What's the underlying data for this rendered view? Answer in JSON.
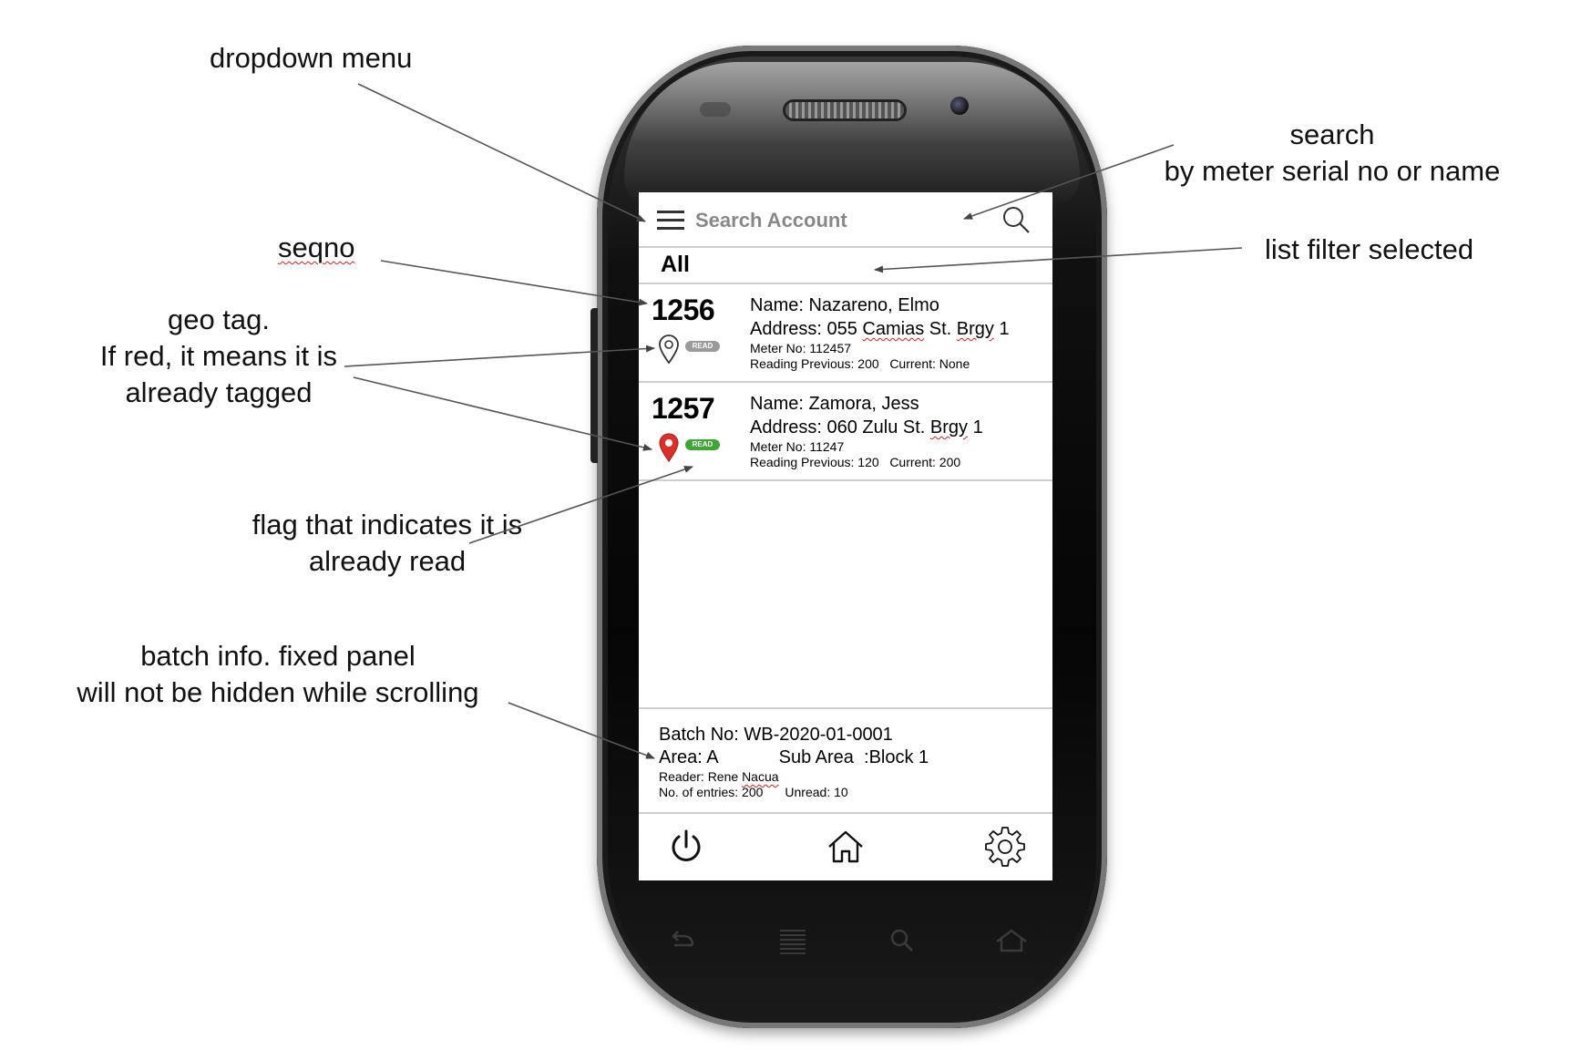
{
  "annotations": {
    "dropdown_menu": "dropdown menu",
    "search_line1": "search",
    "search_line2": "by meter serial no or name",
    "seqno": "seqno",
    "list_filter": "list filter selected",
    "geo_tag_line1": "geo tag.",
    "geo_tag_line2": "If red, it means it is",
    "geo_tag_line3": "already tagged",
    "flag_line1": "flag that indicates it is",
    "flag_line2": "already read",
    "batch_line1": "batch info. fixed panel",
    "batch_line2": "will not be hidden while scrolling"
  },
  "header": {
    "search_placeholder": "Search Account",
    "menu_icon": "hamburger-menu-icon",
    "search_icon": "magnifier-icon"
  },
  "filter": {
    "selected": "All"
  },
  "accounts": [
    {
      "seqno": "1256",
      "name": "Name: Nazareno, Elmo",
      "address_prefix": "Address: 055 ",
      "address_street": "Camias",
      "address_mid": " St. ",
      "address_brgy": "Brgy",
      "address_suffix": " 1",
      "meter": "Meter No: 112457",
      "reading": "Reading Previous: 200   Current: None",
      "badge": "READ",
      "geo_tagged": false,
      "is_read": false
    },
    {
      "seqno": "1257",
      "name": "Name: Zamora, Jess",
      "address_prefix": "Address: 060 Zulu St. ",
      "address_brgy": "Brgy",
      "address_suffix": " 1",
      "meter": "Meter No: 11247",
      "reading": "Reading Previous: 120   Current: 200",
      "badge": "READ",
      "geo_tagged": true,
      "is_read": true
    }
  ],
  "batch": {
    "batch_no": "Batch No: WB-2020-01-0001",
    "area": "Area: A",
    "sub_area": "Sub Area  :Block 1",
    "reader_prefix": "Reader: Rene ",
    "reader_surname": "Nacua",
    "entries": "No. of entries: 200",
    "unread": "Unread: 10"
  },
  "nav": {
    "power_icon": "power-icon",
    "home_icon": "home-icon",
    "settings_icon": "gear-icon"
  },
  "colors": {
    "tag_red": "#d9302b",
    "read_green": "#3fa535",
    "unread_gray": "#9a9a9a",
    "divider": "#cfcfcf"
  }
}
